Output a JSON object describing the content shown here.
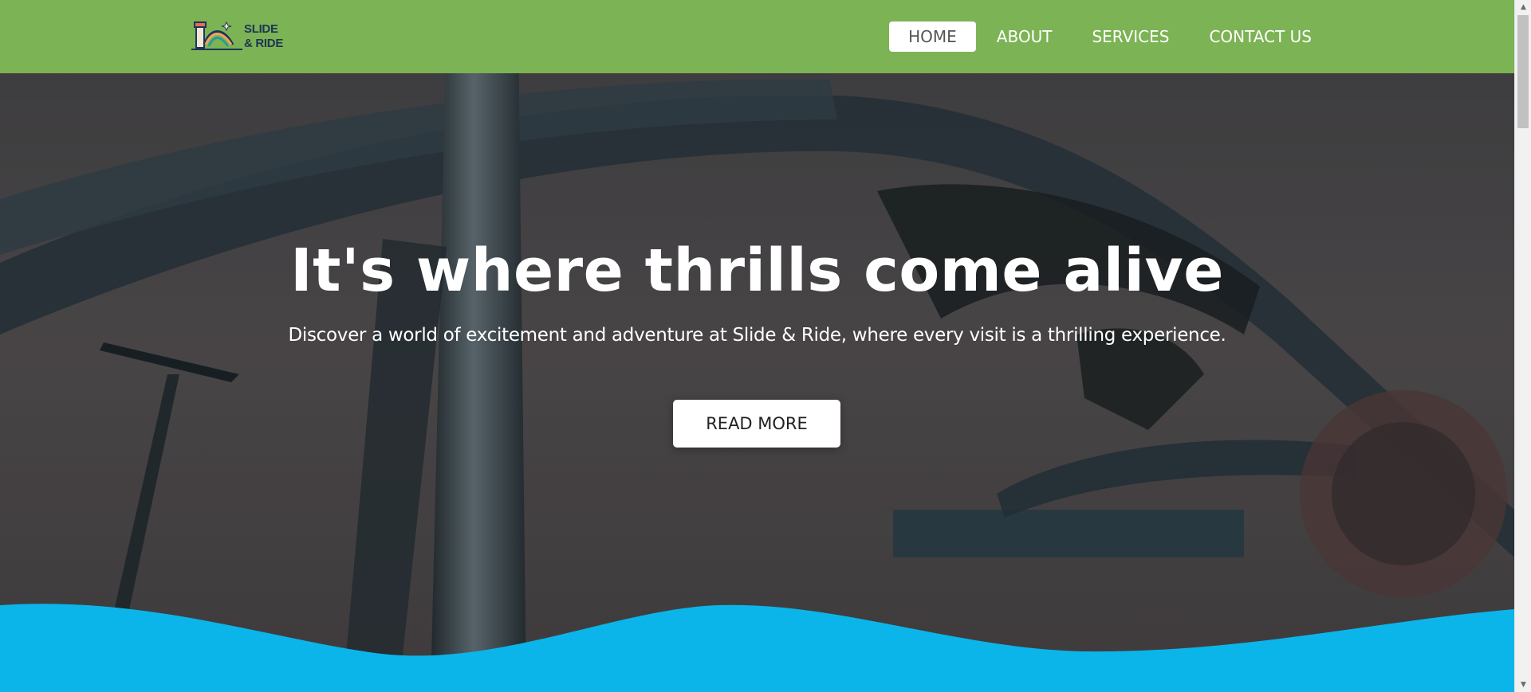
{
  "brand": {
    "logo_line1": "SLIDE",
    "logo_line2": "& RIDE",
    "logo_icon": "roller-coaster-logo-icon"
  },
  "nav": {
    "items": [
      {
        "label": "HOME",
        "active": true
      },
      {
        "label": "ABOUT",
        "active": false
      },
      {
        "label": "SERVICES",
        "active": false
      },
      {
        "label": "CONTACT US",
        "active": false
      }
    ]
  },
  "hero": {
    "title": "It's where thrills come alive",
    "subtitle": "Discover a world of excitement and adventure at Slide & Ride, where every visit is a thrilling experience.",
    "button_label": "READ MORE",
    "background_image": "roller-coaster-photo"
  },
  "scrollbar": {
    "up_icon": "▲",
    "down_icon": "▼"
  },
  "colors": {
    "navbar": "#7cb354",
    "wave": "#0bb5ea",
    "wave_shadow": "#1b7fa8",
    "logo_text": "#1d3557",
    "active_nav_text": "#555555"
  }
}
